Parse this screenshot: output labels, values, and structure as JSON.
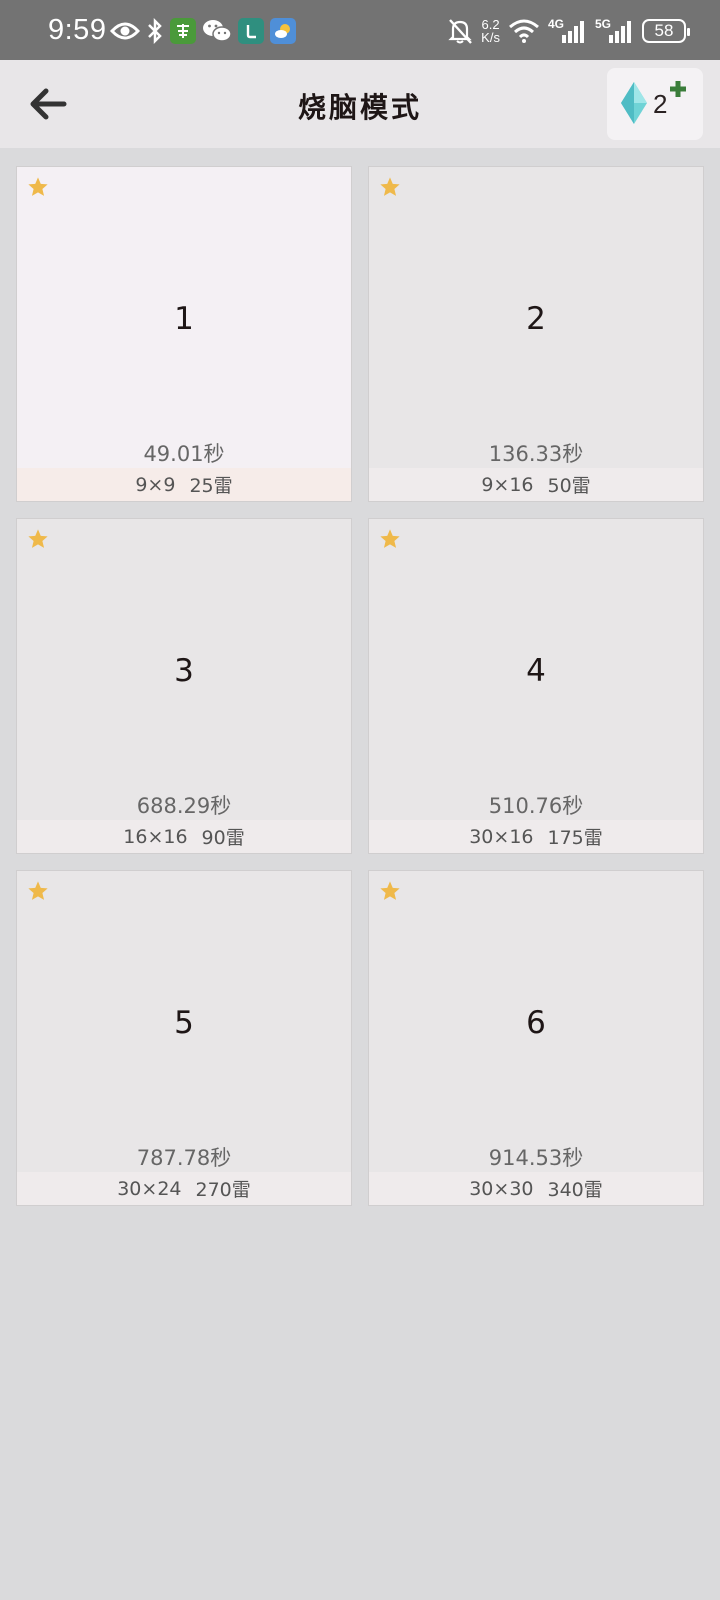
{
  "status_bar": {
    "time": "9:59",
    "net_speed_value": "6.2",
    "net_speed_unit": "K/s",
    "signal_1_label": "4G",
    "signal_2_label": "5G",
    "battery": "58",
    "icons_left": [
      "eye-icon",
      "bluetooth-icon",
      "app-icon-green",
      "wechat-icon",
      "app-icon-teal",
      "weather-icon"
    ],
    "icons_right": [
      "bell-muted-icon",
      "wifi-icon",
      "signal-icon",
      "signal-icon"
    ]
  },
  "header": {
    "title": "烧脑模式",
    "gem_count": "2",
    "back_icon": "arrow-left-icon",
    "gem_icon": "diamond-icon",
    "plus_icon": "plus-icon"
  },
  "colors": {
    "status_bar_bg": "#737373",
    "header_bg": "#e8e6e8",
    "page_bg": "#dadadc",
    "star": "#efb94a",
    "gem": "#6fd3d6",
    "plus": "#3a7d3a"
  },
  "levels": [
    {
      "number": "1",
      "best_time": "49.01秒",
      "size": "9×9",
      "mines": "25雷",
      "starred": true
    },
    {
      "number": "2",
      "best_time": "136.33秒",
      "size": "9×16",
      "mines": "50雷",
      "starred": true
    },
    {
      "number": "3",
      "best_time": "688.29秒",
      "size": "16×16",
      "mines": "90雷",
      "starred": true
    },
    {
      "number": "4",
      "best_time": "510.76秒",
      "size": "30×16",
      "mines": "175雷",
      "starred": true
    },
    {
      "number": "5",
      "best_time": "787.78秒",
      "size": "30×24",
      "mines": "270雷",
      "starred": true
    },
    {
      "number": "6",
      "best_time": "914.53秒",
      "size": "30×30",
      "mines": "340雷",
      "starred": true
    }
  ]
}
